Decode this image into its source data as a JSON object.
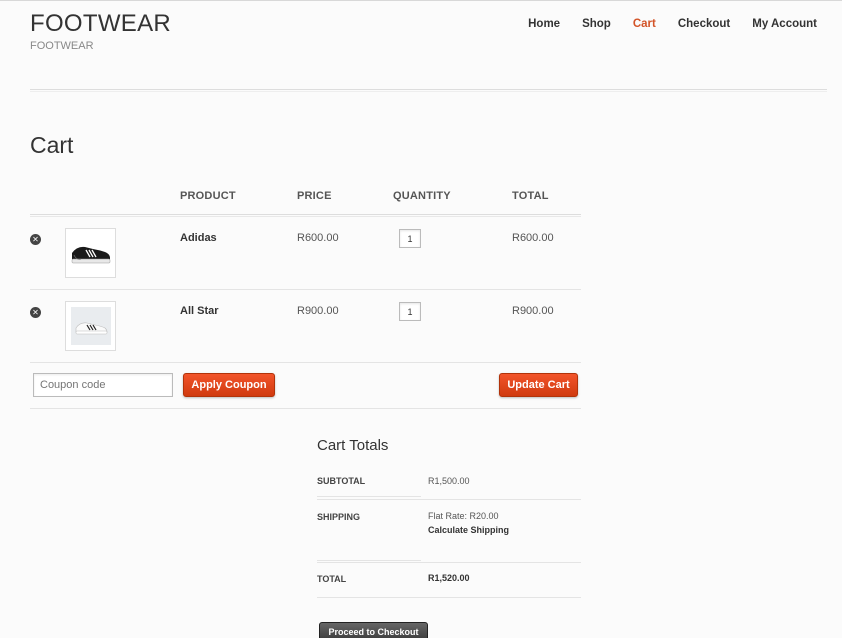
{
  "site": {
    "title": "FOOTWEAR",
    "tagline": "FOOTWEAR"
  },
  "nav": {
    "items": [
      {
        "label": "Home"
      },
      {
        "label": "Shop"
      },
      {
        "label": "Cart",
        "active": true
      },
      {
        "label": "Checkout"
      },
      {
        "label": "My Account"
      }
    ]
  },
  "page": {
    "title": "Cart"
  },
  "cart": {
    "columns": {
      "product": "PRODUCT",
      "price": "PRICE",
      "quantity": "QUANTITY",
      "total": "TOTAL"
    },
    "items": [
      {
        "name": "Adidas",
        "price": "R600.00",
        "quantity": "1",
        "total": "R600.00",
        "image_icon": "black-sneaker-icon"
      },
      {
        "name": "All Star",
        "price": "R900.00",
        "quantity": "1",
        "total": "R900.00",
        "image_icon": "white-sneaker-icon"
      }
    ],
    "remove_icon": "remove-x-icon",
    "coupon_placeholder": "Coupon code",
    "apply_coupon_label": "Apply Coupon",
    "update_cart_label": "Update Cart"
  },
  "totals": {
    "title": "Cart Totals",
    "subtotal_label": "SUBTOTAL",
    "subtotal_value": "R1,500.00",
    "shipping_label": "SHIPPING",
    "shipping_value": "Flat Rate: R20.00",
    "calculate_shipping_label": "Calculate Shipping",
    "total_label": "TOTAL",
    "total_value": "R1,520.00",
    "checkout_label": "Proceed to Checkout"
  },
  "colors": {
    "accent": "#d35428",
    "button_orange": "#e2461c",
    "checkout_dark": "#4a4a4a"
  }
}
